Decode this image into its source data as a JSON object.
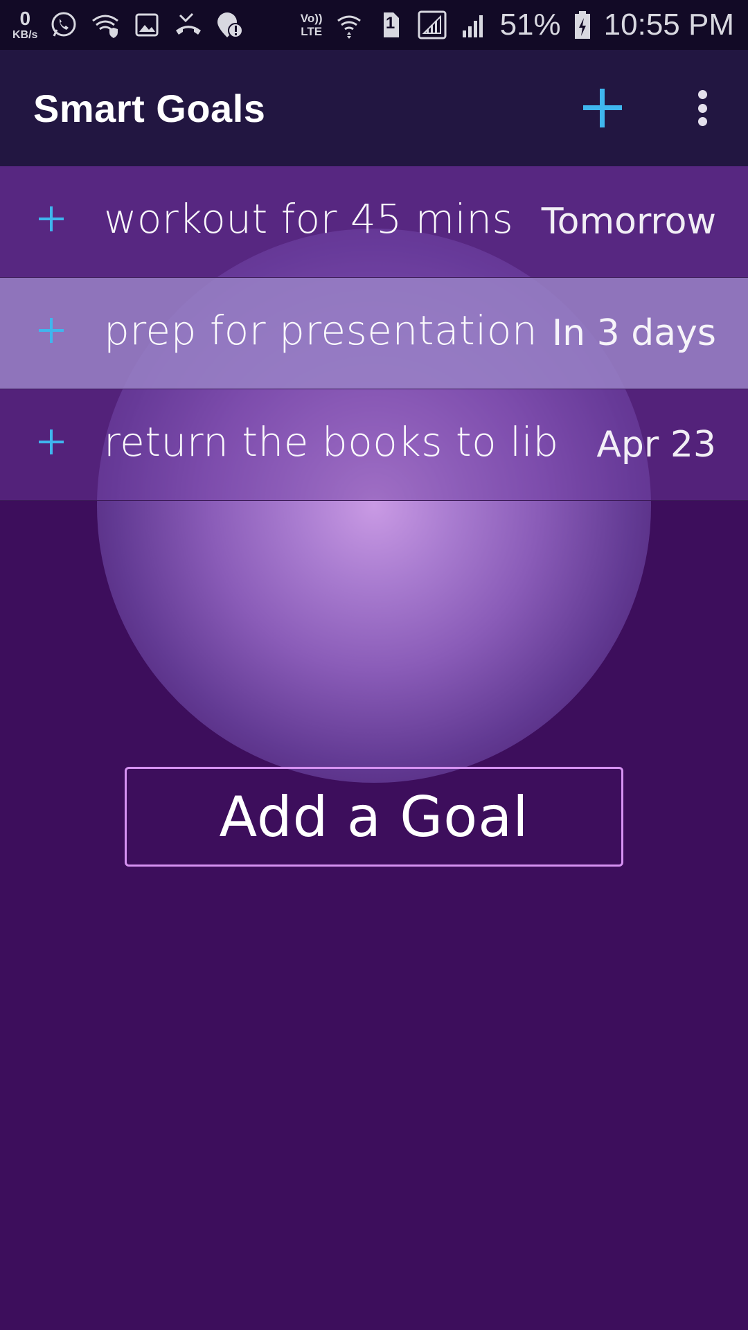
{
  "status_bar": {
    "net_speed_value": "0",
    "net_speed_unit": "KB/s",
    "volte_top": "Vo))",
    "volte_bottom": "LTE",
    "sim_label": "1",
    "battery_percent": "51%",
    "time": "10:55 PM",
    "icons": [
      "whatsapp-icon",
      "wifi-shield-icon",
      "gallery-icon",
      "missed-call-icon",
      "alert-location-icon",
      "wifi-signal-icon",
      "sim-icon",
      "signal-icon",
      "signal-icon-2",
      "battery-icon"
    ]
  },
  "app_bar": {
    "title": "Smart Goals",
    "add_icon": "plus-icon",
    "menu_icon": "more-vert-icon"
  },
  "goals": [
    {
      "text": "workout for 45 mins",
      "due": "Tomorrow"
    },
    {
      "text": "prep for presentation",
      "due": "In 3 days"
    },
    {
      "text": "return the books to lib",
      "due": "Apr 23"
    }
  ],
  "add_goal_button": {
    "label": "Add a Goal"
  },
  "colors": {
    "accent_plus": "#3fb6ee",
    "background": "#3d0e5c",
    "app_bar": "#221641",
    "status_bar": "#120a26",
    "button_border": "#d692f2"
  }
}
